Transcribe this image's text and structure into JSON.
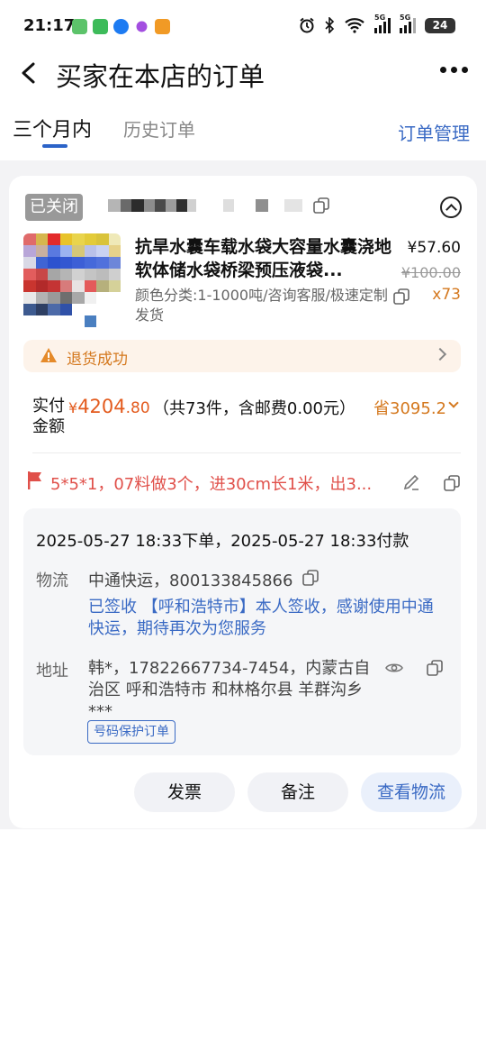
{
  "status_bar": {
    "time": "21:17",
    "battery": "24",
    "network_1": "5G",
    "network_2": "5G",
    "icons": [
      "alarm-icon",
      "bluetooth-icon",
      "wifi-icon",
      "signal-icon",
      "signal-icon",
      "battery-icon"
    ],
    "app_colors": [
      "#5cc36a",
      "#3dbb5a",
      "#1d7bf2",
      "#a34ee0",
      "#f19a25"
    ]
  },
  "header": {
    "title": "买家在本店的订单"
  },
  "tabs": {
    "active": "三个月内",
    "inactive": "历史订单",
    "manage": "订单管理"
  },
  "order": {
    "status_badge": "已关闭",
    "product": {
      "title": "抗旱水囊车载水袋大容量水囊浇地软体储水袋桥梁预压液袋...",
      "price": "¥57.60",
      "original_price": "¥100.00",
      "spec": "颜色分类:1-1000吨/咨询客服/极速定制发货",
      "quantity": "x73"
    },
    "refund_status": "退货成功",
    "payment": {
      "label": "实付金额",
      "currency": "¥",
      "amount_int": "4204",
      "amount_dec": ".80",
      "detail": "（共73件，含邮费0.00元）",
      "saved": "省3095.2"
    },
    "remark": "5*5*1，07料做3个，进30cm长1米，出3...",
    "info": {
      "times": "2025-05-27 18:33下单，2025-05-27 18:33付款",
      "logistics_label": "物流",
      "logistics_value": "中通快运，800133845866",
      "logistics_status": "已签收 【呼和浩特市】本人签收，感谢使用中通快运，期待再次为您服务",
      "address_label": "地址",
      "address_value": "韩*，17822667734-7454，内蒙古自治区 呼和浩特市 和林格尔县 羊群沟乡 ***",
      "privacy_tag": "号码保护订单"
    },
    "actions": {
      "invoice": "发票",
      "note": "备注",
      "logistics": "查看物流"
    },
    "colors": {
      "accent_blue": "#3a6ac4",
      "accent_orange": "#d4781e",
      "price_red": "#e35b1e",
      "remark_red": "#e0504a"
    }
  }
}
